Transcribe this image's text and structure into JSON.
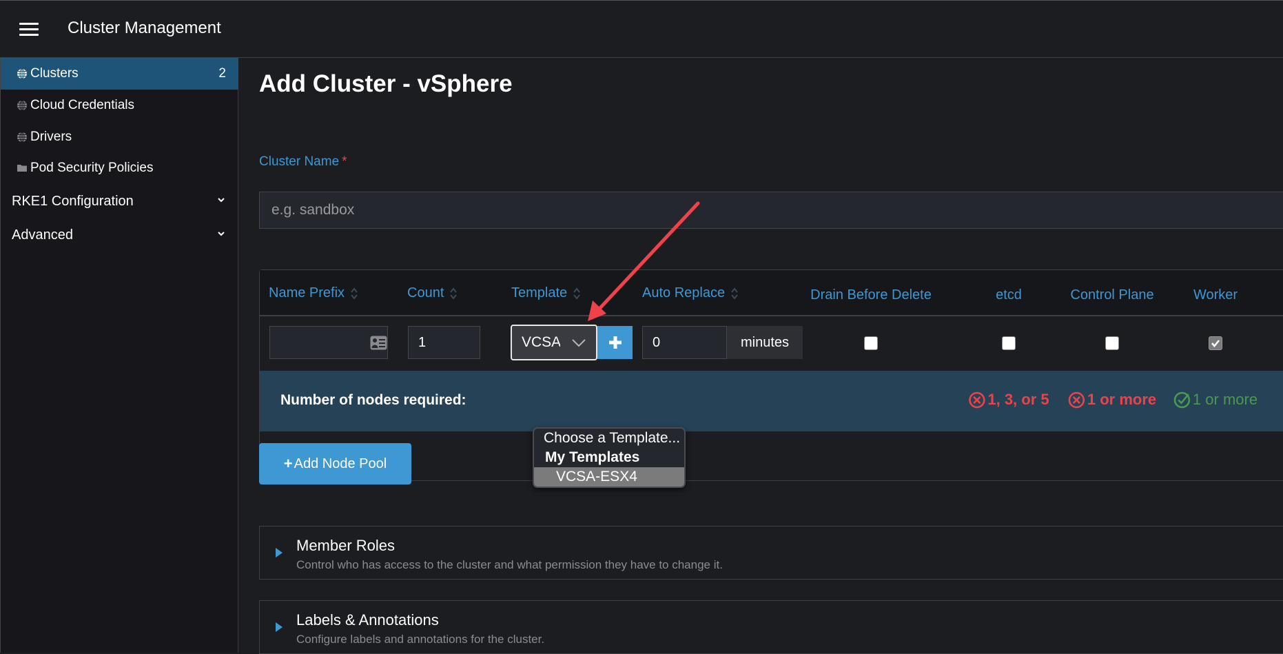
{
  "header": {
    "menu_icon": "hamburger-menu-icon",
    "title": "Cluster Management"
  },
  "sidebar": {
    "items": [
      {
        "label": "Clusters",
        "icon": "globe-icon",
        "count": "2",
        "active": true
      },
      {
        "label": "Cloud Credentials",
        "icon": "globe-icon"
      },
      {
        "label": "Drivers",
        "icon": "globe-icon"
      },
      {
        "label": "Pod Security Policies",
        "icon": "folder-icon"
      }
    ],
    "groups": [
      {
        "label": "RKE1 Configuration",
        "icon": "chevron-down-icon"
      },
      {
        "label": "Advanced",
        "icon": "chevron-down-icon"
      }
    ]
  },
  "main": {
    "title": "Add Cluster - vSphere",
    "cluster_name": {
      "label": "Cluster Name",
      "required_mark": "*",
      "placeholder": "e.g. sandbox",
      "value": ""
    },
    "node_pool_table": {
      "columns": [
        {
          "label": "Name Prefix",
          "sortable": true
        },
        {
          "label": "Count",
          "sortable": true
        },
        {
          "label": "Template",
          "sortable": true
        },
        {
          "label": "Auto Replace",
          "sortable": true
        },
        {
          "label": "Drain Before Delete",
          "sortable": false
        },
        {
          "label": "etcd",
          "sortable": false
        },
        {
          "label": "Control Plane",
          "sortable": false
        },
        {
          "label": "Worker",
          "sortable": false
        }
      ],
      "row": {
        "name_prefix": "",
        "count": "1",
        "template": "VCSA-ESX4",
        "auto_replace": "0",
        "auto_replace_unit": "minutes",
        "drain_before_delete": false,
        "etcd": false,
        "control_plane": false,
        "worker": true
      },
      "requirements": {
        "label": "Number of nodes required:",
        "etcd": {
          "text": "1, 3, or 5",
          "status": "error"
        },
        "control_plane": {
          "text": "1 or more",
          "status": "error"
        },
        "worker": {
          "text": "1 or more",
          "status": "ok"
        }
      }
    },
    "template_dropdown": {
      "placeholder_option": "Choose a Template...",
      "group_label": "My Templates",
      "options": [
        {
          "label": "VCSA-ESX4",
          "highlighted": true
        }
      ]
    },
    "add_node_pool_label": "Add Node Pool",
    "sections": [
      {
        "title": "Member Roles",
        "description": "Control who has access to the cluster and what permission they have to change it."
      },
      {
        "title": "Labels & Annotations",
        "description": "Configure labels and annotations for the cluster."
      }
    ]
  },
  "colors": {
    "accent": "#3d98d3",
    "active_nav": "#1d5478",
    "requirements_bg": "#264257",
    "error": "#f04148",
    "success": "#4a9a4e",
    "annotation_arrow": "#f0424a"
  }
}
